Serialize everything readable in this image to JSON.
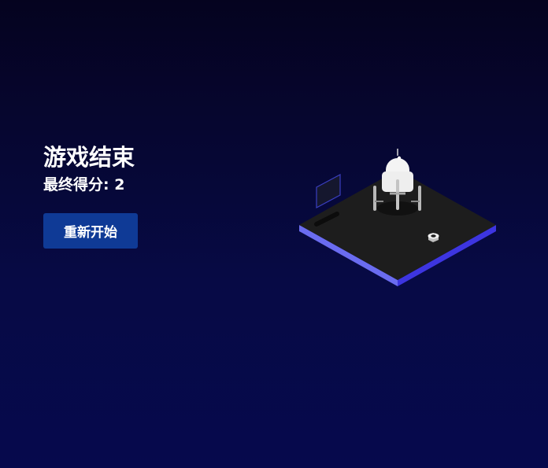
{
  "game_over": {
    "title": "游戏结束",
    "score_label": "最终得分:",
    "score_value": "2",
    "restart_label": "重新开始"
  },
  "colors": {
    "background_top": "#05031f",
    "background_bottom": "#06094d",
    "button": "#0f3a96",
    "board_top": "#1c1c1c",
    "board_edge": "#5b5cff",
    "robot": "#f2f2f2"
  },
  "icons": {
    "robot": "robot-icon",
    "nut": "hex-nut-icon",
    "panel": "wall-panel-icon"
  }
}
